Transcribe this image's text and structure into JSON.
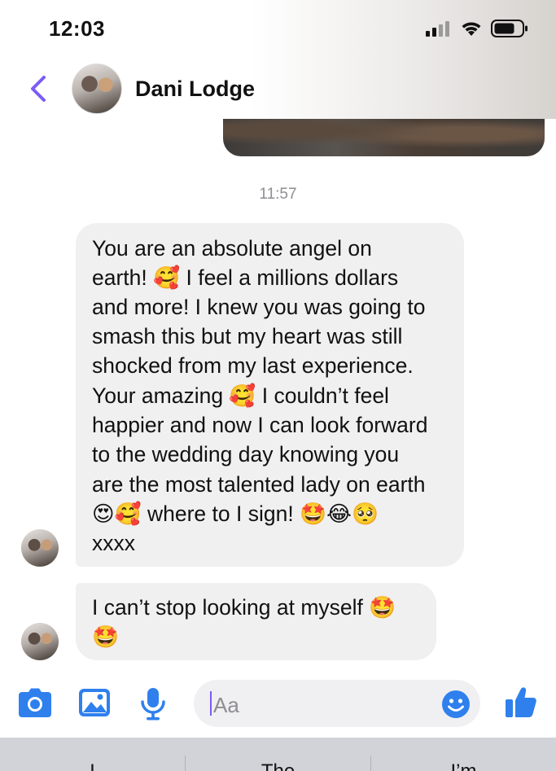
{
  "status_bar": {
    "time": "12:03"
  },
  "header": {
    "contact_name": "Dani Lodge"
  },
  "thread": {
    "timestamp": "11:57",
    "message1_lines": [
      "You are an absolute angel on",
      "earth! 🥰 I feel a millions dollars",
      "and more! I knew you was going to",
      "smash this but my heart was still",
      "shocked from my last experience.",
      "Your amazing 🥰 I couldn’t feel",
      "happier and now I can look forward",
      "to the wedding day knowing you",
      "are the most talented lady on earth",
      "😍🥰 where to I sign! 🤩😂🥺",
      "xxxx"
    ],
    "message2_lines": [
      "I can’t stop looking at myself 🤩",
      "🤩"
    ]
  },
  "composer": {
    "placeholder": "Aa"
  },
  "keyboard": {
    "suggestions": [
      "I",
      "The",
      "I’m"
    ]
  },
  "colors": {
    "accent": "#7b5cf5",
    "icon_blue": "#2f80ed",
    "bubble": "#f0f0f0",
    "timestamp": "#8e8e93"
  },
  "icons": [
    "back-chevron-icon",
    "camera-icon",
    "gallery-icon",
    "microphone-icon",
    "emoji-icon",
    "thumbs-up-icon",
    "cellular-icon",
    "wifi-icon",
    "battery-icon"
  ]
}
